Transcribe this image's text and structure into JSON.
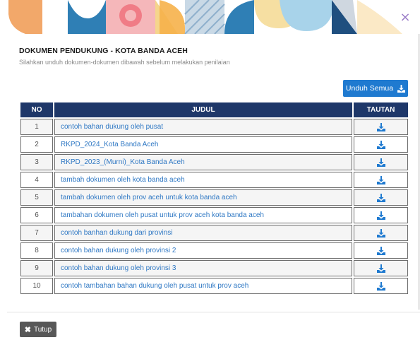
{
  "modal": {
    "close_icon": "×",
    "title": "DOKUMEN PENDUKUNG - KOTA BANDA ACEH",
    "subtitle": "Silahkan unduh dokumen-dokumen dibawah sebelum melakukan penilaian",
    "download_all_label": "Unduh Semua",
    "close_button_label": "Tutup",
    "close_button_glyph": "✖"
  },
  "colors": {
    "header_bg": "#1e3769",
    "primary_button": "#1f7ad0",
    "link": "#2f78c4",
    "download_icon": "#1f7ad0",
    "close_button": "#575757"
  },
  "table": {
    "headers": {
      "no": "NO",
      "judul": "JUDUL",
      "tautan": "TAUTAN"
    },
    "rows": [
      {
        "no": "1",
        "judul": "contoh bahan dukung oleh pusat"
      },
      {
        "no": "2",
        "judul": "RKPD_2024_Kota Banda Aceh"
      },
      {
        "no": "3",
        "judul": "RKPD_2023_(Murni)_Kota Banda Aceh"
      },
      {
        "no": "4",
        "judul": "tambah dokumen oleh kota banda aceh"
      },
      {
        "no": "5",
        "judul": "tambah dokumen oleh prov aceh untuk kota banda aceh"
      },
      {
        "no": "6",
        "judul": "tambahan dokumen oleh pusat untuk prov aceh kota banda aceh"
      },
      {
        "no": "7",
        "judul": "contoh banhan dukung dari provinsi"
      },
      {
        "no": "8",
        "judul": "contoh bahan dukung oleh provinsi 2"
      },
      {
        "no": "9",
        "judul": "contoh bahan dukung oleh provinsi 3"
      },
      {
        "no": "10",
        "judul": "contoh tambahan bahan dukung oleh pusat untuk prov aceh"
      }
    ]
  }
}
